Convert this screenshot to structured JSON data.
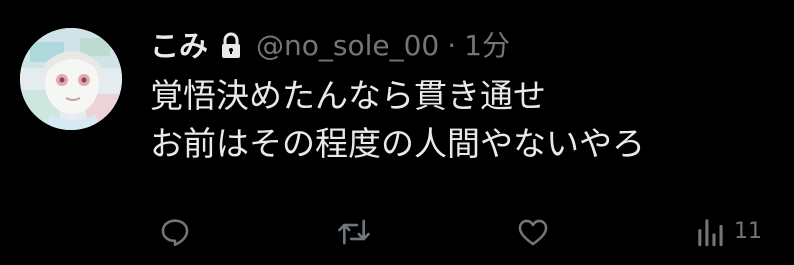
{
  "tweet": {
    "display_name": "こみ",
    "handle": "@no_sole_00",
    "separator": "·",
    "time": "1分",
    "lines": [
      "覚悟決めたんなら貫き通せ",
      "お前はその程度の人間やないやろ"
    ],
    "views": "11"
  },
  "icons": {
    "lock": "lock-icon",
    "reply": "reply-icon",
    "retweet": "retweet-icon",
    "like": "heart-icon",
    "views": "views-chart-icon"
  },
  "colors": {
    "background": "#000000",
    "primary_text": "#e7e9ea",
    "secondary_text": "#71767b"
  }
}
